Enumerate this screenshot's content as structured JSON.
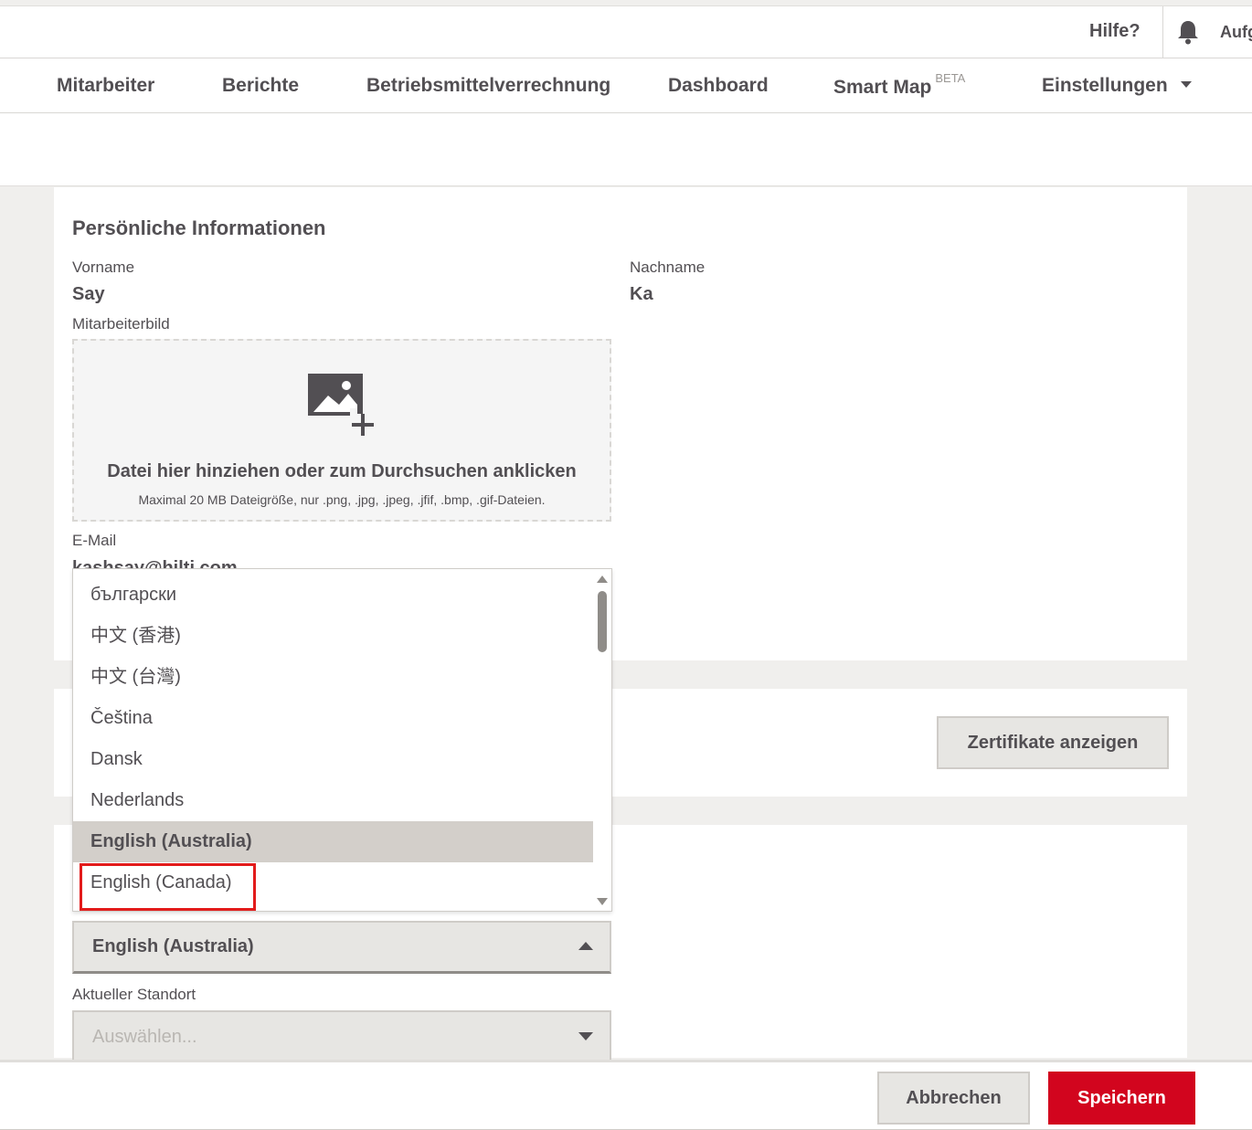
{
  "topbar": {
    "help": "Hilfe?",
    "tasks_label": "Aufg"
  },
  "nav": {
    "items": [
      "Mitarbeiter",
      "Berichte",
      "Betriebsmittelverrechnung",
      "Dashboard",
      "Smart Map",
      "Einstellungen"
    ],
    "smart_map_badge": "BETA"
  },
  "personal": {
    "title": "Persönliche Informationen",
    "first_name_label": "Vorname",
    "first_name": "Say",
    "last_name_label": "Nachname",
    "last_name": "Ka",
    "photo_label": "Mitarbeiterbild",
    "dropzone_title": "Datei hier hinziehen oder zum Durchsuchen anklicken",
    "dropzone_hint": "Maximal 20 MB Dateigröße, nur .png, .jpg, .jpeg, .jfif, .bmp, .gif-Dateien.",
    "email_label": "E-Mail",
    "email": "kashsay@hilti.com"
  },
  "certificates": {
    "button": "Zertifikate anzeigen"
  },
  "language": {
    "selected": "English (Australia)",
    "options": [
      "български",
      "中文 (香港)",
      "中文 (台灣)",
      "Čeština",
      "Dansk",
      "Nederlands",
      "English (Australia)",
      "English (Canada)"
    ]
  },
  "location": {
    "label": "Aktueller Standort",
    "placeholder": "Auswählen..."
  },
  "footer": {
    "cancel": "Abbrechen",
    "save": "Speichern"
  },
  "colors": {
    "primary": "#d2051e",
    "highlight": "#e21b1b",
    "text": "#524f53",
    "selected_option": "#d3cfca"
  }
}
